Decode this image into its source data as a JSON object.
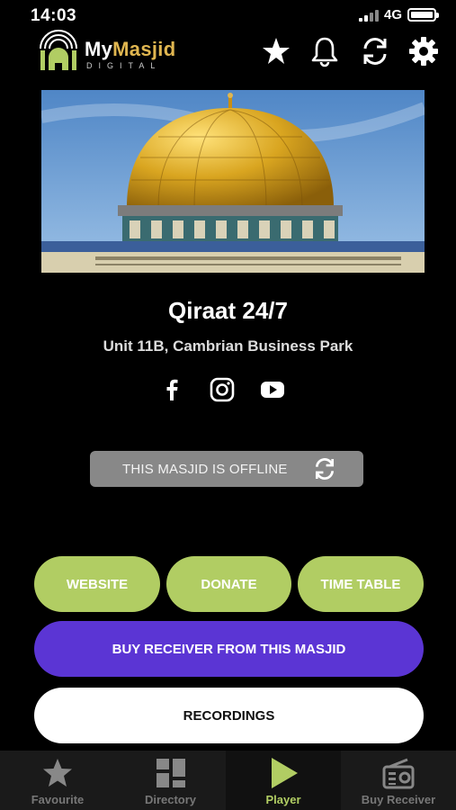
{
  "status_bar": {
    "time": "14:03",
    "network": "4G"
  },
  "app": {
    "logo_my": "My",
    "logo_masjid": "Masjid",
    "logo_sub": "DIGITAL"
  },
  "header_icons": [
    "star-icon",
    "bell-icon",
    "refresh-icon",
    "gear-icon"
  ],
  "masjid": {
    "name": "Qiraat 24/7",
    "address": "Unit 11B, Cambrian Business Park",
    "status": "THIS MASJID IS OFFLINE"
  },
  "socials": [
    "facebook-icon",
    "instagram-icon",
    "youtube-icon"
  ],
  "actions": {
    "website": "WEBSITE",
    "donate": "DONATE",
    "timetable": "TIME TABLE",
    "buy_receiver": "BUY RECEIVER FROM THIS MASJID",
    "recordings": "RECORDINGS"
  },
  "tabs": [
    {
      "label": "Favourite",
      "icon": "star-icon"
    },
    {
      "label": "Directory",
      "icon": "grid-icon"
    },
    {
      "label": "Player",
      "icon": "play-icon",
      "active": true
    },
    {
      "label": "Buy Receiver",
      "icon": "radio-icon"
    }
  ],
  "colors": {
    "accent_green": "#b1cd63",
    "accent_purple": "#5b35d4",
    "gold": "#e0b650"
  }
}
